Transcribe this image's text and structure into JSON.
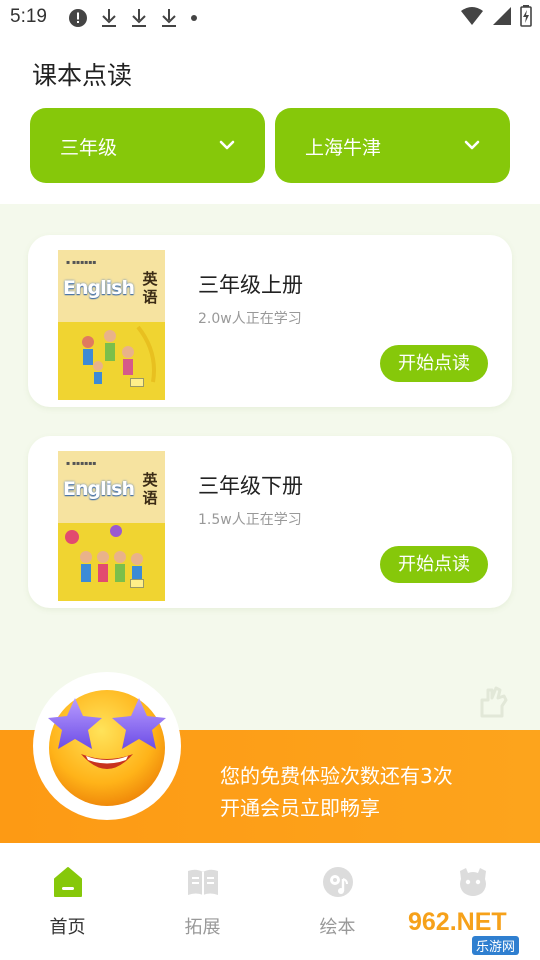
{
  "status_bar": {
    "time": "5:19",
    "left_icons": [
      "alert-icon",
      "download-icon",
      "download-icon",
      "download-icon",
      "dot-icon"
    ],
    "right_icons": [
      "wifi-icon",
      "signal-icon",
      "battery-icon"
    ]
  },
  "header": {
    "title": "课本点读"
  },
  "filters": {
    "grade": {
      "label": "三年级",
      "icon": "chevron-down-icon"
    },
    "edition": {
      "label": "上海牛津",
      "icon": "chevron-down-icon"
    }
  },
  "books": [
    {
      "title": "三年级上册",
      "learners": "2.0w人正在学习",
      "button": "开始点读",
      "cover": {
        "english": "English",
        "chinese": "英语"
      }
    },
    {
      "title": "三年级下册",
      "learners": "1.5w人正在学习",
      "button": "开始点读",
      "cover": {
        "english": "English",
        "chinese": "英语"
      }
    }
  ],
  "promo": {
    "line1": "您的免费体验次数还有3次",
    "line2": "开通会员立即畅享"
  },
  "tabbar": {
    "tabs": [
      {
        "label": "首页",
        "icon": "home-icon",
        "active": true
      },
      {
        "label": "拓展",
        "icon": "book-open-icon",
        "active": false
      },
      {
        "label": "绘本",
        "icon": "music-disc-icon",
        "active": false
      },
      {
        "label": "",
        "icon": "face-icon",
        "active": false
      }
    ]
  },
  "watermark": {
    "text": "962.NET",
    "subtext": "乐游网"
  },
  "colors": {
    "accent_green": "#86c80a",
    "promo_orange": "#fd9a14",
    "page_bg": "#f4f9ec"
  }
}
